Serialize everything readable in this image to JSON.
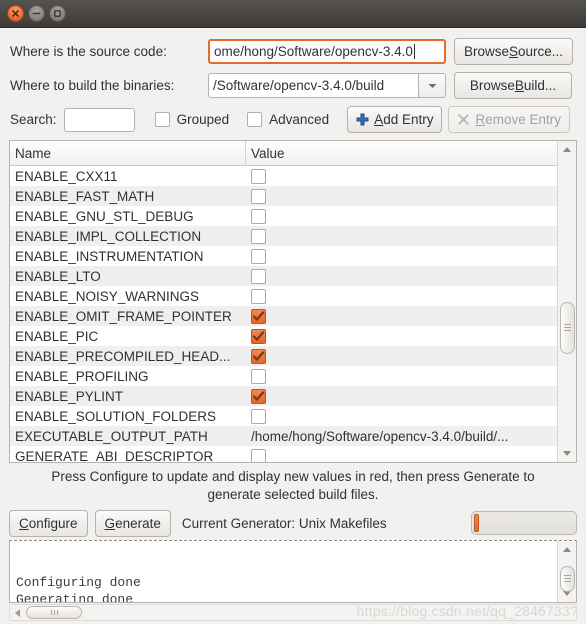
{
  "window": {
    "titlebar_buttons": [
      {
        "name": "close",
        "icon": "close-icon"
      },
      {
        "name": "minimize",
        "icon": "minimize-icon"
      },
      {
        "name": "maximize",
        "icon": "maximize-icon"
      }
    ]
  },
  "form": {
    "source_label": "Where is the source code:",
    "source_value": "ome/hong/Software/opencv-3.4.0",
    "browse_source_pre": "Browse ",
    "browse_source_mn": "S",
    "browse_source_post": "ource...",
    "build_label": "Where to build the binaries:",
    "build_value": "/Software/opencv-3.4.0/build",
    "browse_build_pre": "Browse ",
    "browse_build_mn": "B",
    "browse_build_post": "uild...",
    "search_label": "Search:",
    "search_value": "",
    "search_placeholder": "",
    "grouped_label": "Grouped",
    "grouped_checked": false,
    "advanced_label": "Advanced",
    "advanced_checked": false,
    "add_entry_pre": "",
    "add_entry_mn": "A",
    "add_entry_post": "dd Entry",
    "remove_entry_pre": "",
    "remove_entry_mn": "R",
    "remove_entry_post": "emove Entry",
    "remove_entry_disabled": true
  },
  "table": {
    "columns": [
      "Name",
      "Value"
    ],
    "rows": [
      {
        "name": "ENABLE_CXX11",
        "type": "checkbox",
        "checked": false
      },
      {
        "name": "ENABLE_FAST_MATH",
        "type": "checkbox",
        "checked": false
      },
      {
        "name": "ENABLE_GNU_STL_DEBUG",
        "type": "checkbox",
        "checked": false
      },
      {
        "name": "ENABLE_IMPL_COLLECTION",
        "type": "checkbox",
        "checked": false
      },
      {
        "name": "ENABLE_INSTRUMENTATION",
        "type": "checkbox",
        "checked": false
      },
      {
        "name": "ENABLE_LTO",
        "type": "checkbox",
        "checked": false
      },
      {
        "name": "ENABLE_NOISY_WARNINGS",
        "type": "checkbox",
        "checked": false
      },
      {
        "name": "ENABLE_OMIT_FRAME_POINTER",
        "type": "checkbox",
        "checked": true
      },
      {
        "name": "ENABLE_PIC",
        "type": "checkbox",
        "checked": true
      },
      {
        "name": "ENABLE_PRECOMPILED_HEAD...",
        "type": "checkbox",
        "checked": true
      },
      {
        "name": "ENABLE_PROFILING",
        "type": "checkbox",
        "checked": false
      },
      {
        "name": "ENABLE_PYLINT",
        "type": "checkbox",
        "checked": true
      },
      {
        "name": "ENABLE_SOLUTION_FOLDERS",
        "type": "checkbox",
        "checked": false
      },
      {
        "name": "EXECUTABLE_OUTPUT_PATH",
        "type": "text",
        "value": "/home/hong/Software/opencv-3.4.0/build/..."
      },
      {
        "name": "GENERATE_ABI_DESCRIPTOR",
        "type": "checkbox",
        "checked": false
      }
    ]
  },
  "hint": {
    "line1": "Press Configure to update and display new values in red, then press Generate to",
    "line2": "generate selected build files."
  },
  "actions": {
    "configure_pre": "",
    "configure_mn": "C",
    "configure_post": "onfigure",
    "generate_pre": "",
    "generate_mn": "G",
    "generate_post": "enerate",
    "generator_label": "Current Generator: Unix Makefiles",
    "progress_percent": 5
  },
  "log": {
    "text": "\nConfiguring done\nGenerating done"
  },
  "watermark": {
    "text": "https://blog.csdn.net/qq_2846733?"
  },
  "colors": {
    "accent_orange": "#e2672c",
    "titlebar": "#4a4744",
    "window_bg": "#f2f1f0",
    "row_alt": "#f0efee"
  }
}
